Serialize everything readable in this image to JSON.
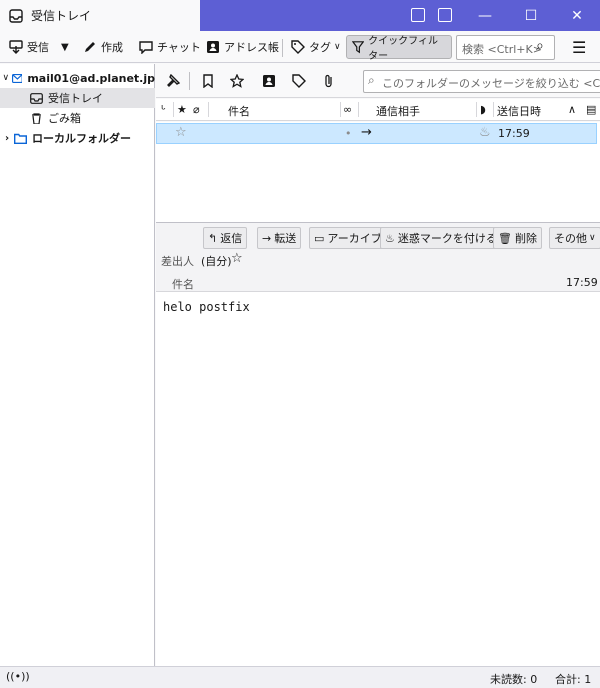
{
  "window": {
    "tab_title": "受信トレイ",
    "accent_color": "#5d5fd4"
  },
  "toolbar": {
    "get_mail": "受信",
    "write": "作成",
    "chat": "チャット",
    "address_book": "アドレス帳",
    "tag": "タグ",
    "quick_filter": "クイックフィルター",
    "search_placeholder": "検索 <Ctrl+K>"
  },
  "folders": {
    "account": "mail01@ad.planet.jp",
    "inbox": "受信トレイ",
    "trash": "ごみ箱",
    "local_folders": "ローカルフォルダー"
  },
  "list_toolbar": {
    "quick_filter_placeholder": "このフォルダーのメッセージを絞り込む <Ctrl+Shift+K>"
  },
  "columns": {
    "subject": "件名",
    "correspondents": "通信相手",
    "date": "送信日時"
  },
  "messages": [
    {
      "subject": "",
      "correspondent": "",
      "date": "17:59",
      "starred": false,
      "direction": "sent"
    }
  ],
  "preview": {
    "reply": "返信",
    "forward": "転送",
    "archive": "アーカイブ",
    "junk": "迷惑マークを付ける",
    "delete": "削除",
    "more": "その他",
    "from_label": "差出人",
    "from_value": "(自分)",
    "subject_label": "件名",
    "time": "17:59",
    "body": "helo postfix"
  },
  "status": {
    "unread": "未読数: 0",
    "total": "合計: 1"
  }
}
